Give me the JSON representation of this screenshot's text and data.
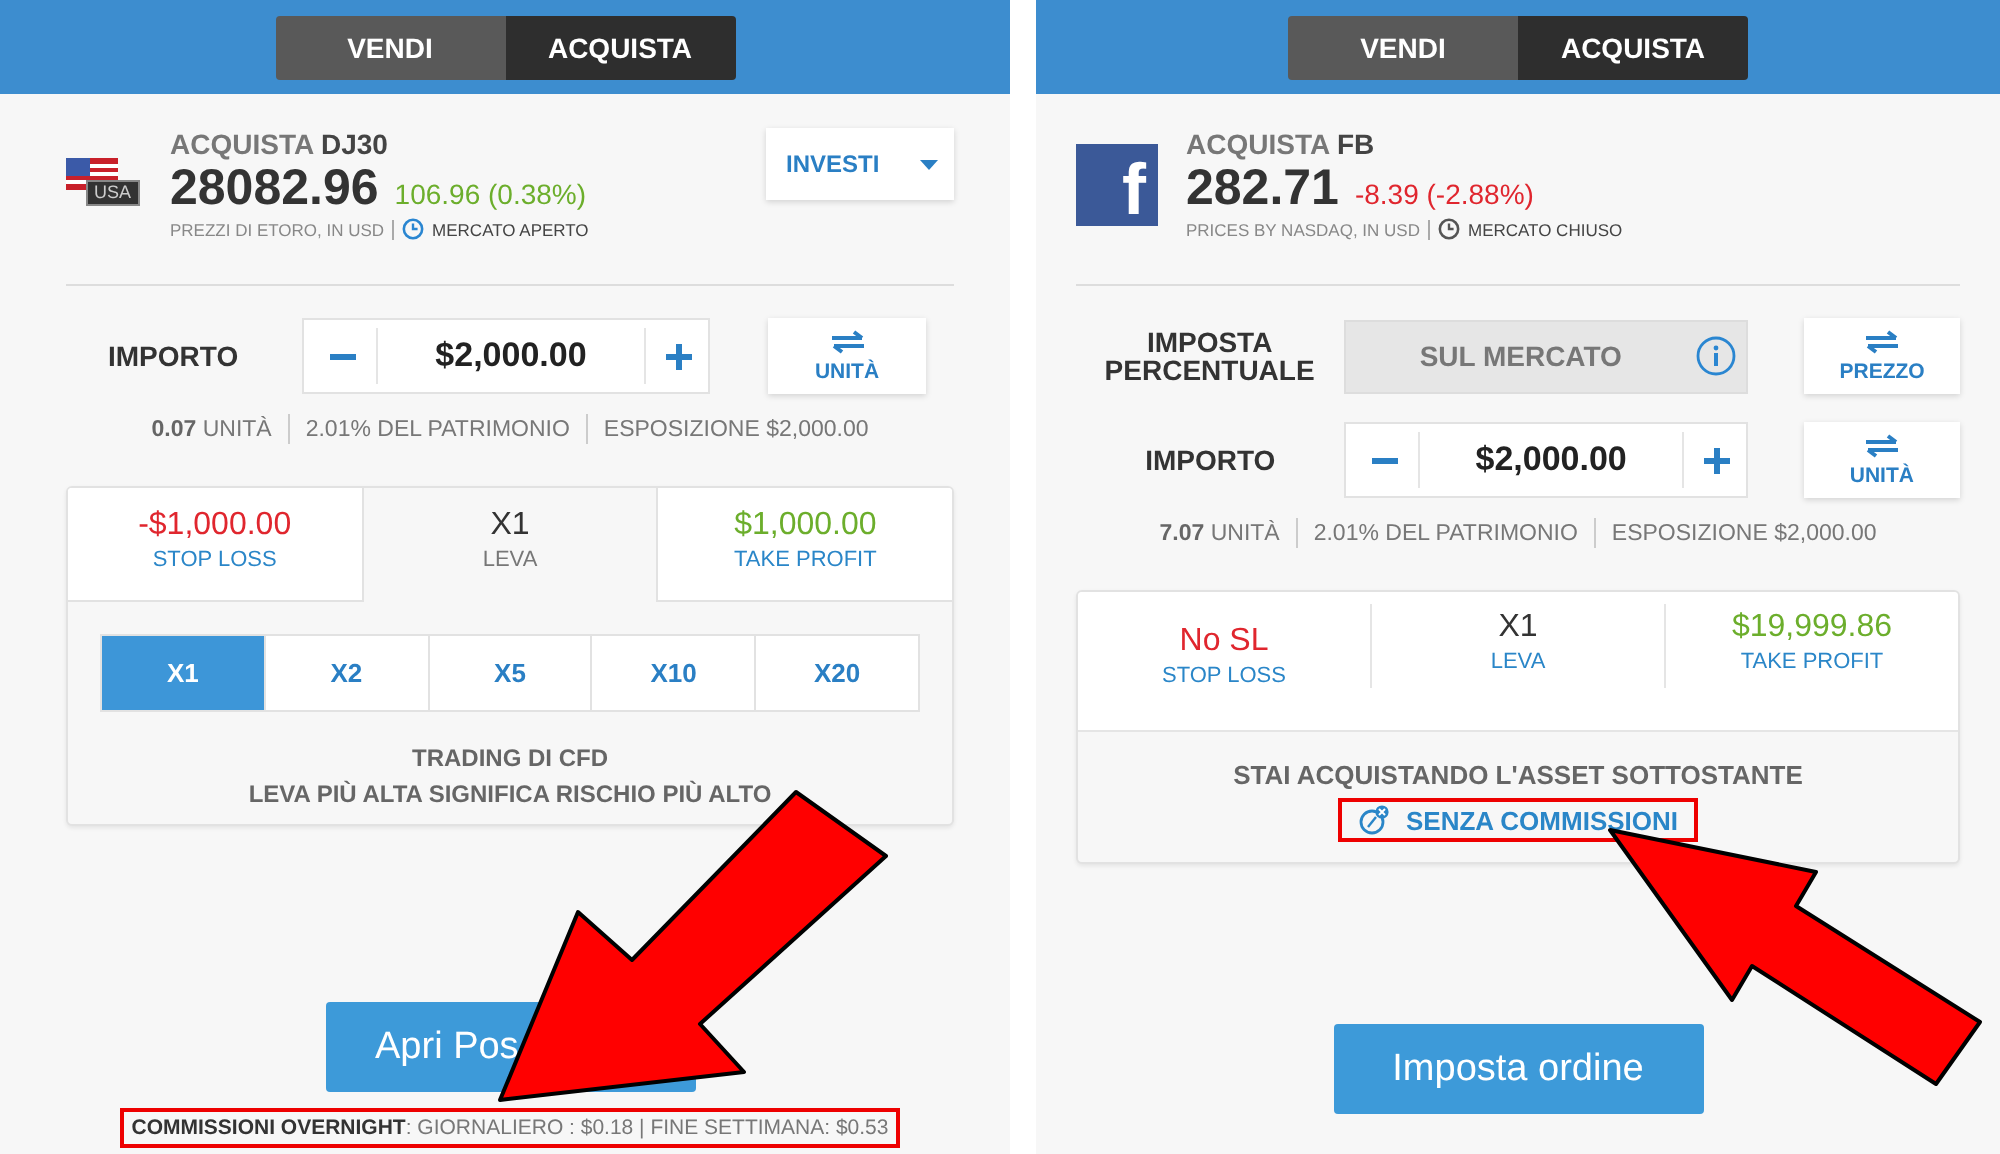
{
  "panels": [
    {
      "toggle": [
        {
          "label": "VENDI",
          "selected": false
        },
        {
          "label": "ACQUISTA",
          "selected": true
        }
      ],
      "instrument": {
        "logo": {
          "kind": "flag",
          "text": "USA"
        },
        "action": "ACQUISTA",
        "symbol": "DJ30",
        "price": "28082.96",
        "change": {
          "text": "106.96 (0.38%)",
          "color": "#6cae2c"
        },
        "source": "PREZZI DI ETORO, IN USD",
        "market": "MERCATO APERTO",
        "market_open": true
      },
      "menu_button": {
        "label": "INVESTI"
      },
      "fields": [
        {
          "kind": "amount",
          "label": "IMPORTO",
          "value": "$2,000.00",
          "switch": "UNITÀ"
        }
      ],
      "stats": [
        "**0.07** UNITÀ",
        "2.01% DEL PATRIMONIO",
        "ESPOSIZIONE $2,000.00"
      ],
      "risk": [
        {
          "value": "-$1,000.00",
          "label": "STOP LOSS",
          "color": "#e0262e",
          "selected": false
        },
        {
          "value": "X1",
          "label": "LEVA",
          "color": "#333333",
          "selected": true
        },
        {
          "value": "$1,000.00",
          "label": "TAKE PROFIT",
          "color": "#6cae2c",
          "selected": false
        }
      ],
      "leverage_options": [
        {
          "label": "X1",
          "selected": true
        },
        {
          "label": "X2",
          "selected": false
        },
        {
          "label": "X5",
          "selected": false
        },
        {
          "label": "X10",
          "selected": false
        },
        {
          "label": "X20",
          "selected": false
        }
      ],
      "notes": [
        "TRADING DI CFD",
        "LEVA PIÙ ALTA SIGNIFICA RISCHIO PIÙ ALTO"
      ],
      "action_button": {
        "label": "Apri Pos"
      },
      "fees_note": {
        "text": "**COMMISSIONI OVERNIGHT**: GIORNALIERO : $0.18 | FINE SETTIMANA: $0.53",
        "highlighted": true
      }
    },
    {
      "toggle": [
        {
          "label": "VENDI",
          "selected": false
        },
        {
          "label": "ACQUISTA",
          "selected": true
        }
      ],
      "instrument": {
        "logo": {
          "kind": "letter",
          "text": "f"
        },
        "action": "ACQUISTA",
        "symbol": "FB",
        "price": "282.71",
        "change": {
          "text": "-8.39 (-2.88%)",
          "color": "#e0262e"
        },
        "source": "PRICES BY NASDAQ, IN USD",
        "market": "MERCATO CHIUSO",
        "market_open": false
      },
      "fields": [
        {
          "kind": "rate",
          "label": "IMPOSTA PERCENTUALE",
          "value": "SUL MERCATO",
          "disabled": true,
          "switch": "PREZZO"
        },
        {
          "kind": "amount",
          "label": "IMPORTO",
          "value": "$2,000.00",
          "switch": "UNITÀ"
        }
      ],
      "stats": [
        "**7.07** UNITÀ",
        "2.01% DEL PATRIMONIO",
        "ESPOSIZIONE $2,000.00"
      ],
      "risk": [
        {
          "value": "No SL",
          "label": "STOP LOSS",
          "color": "#e0262e",
          "selected": false
        },
        {
          "value": "X1",
          "label": "LEVA",
          "color": "#333333",
          "selected": false
        },
        {
          "value": "$19,999.86",
          "label": "TAKE PROFIT",
          "color": "#6cae2c",
          "selected": false
        }
      ],
      "notes": [
        "STAI ACQUISTANDO L'ASSET SOTTOSTANTE"
      ],
      "link": {
        "label": "SENZA COMMISSIONI",
        "highlighted": true
      },
      "action_button": {
        "label": "Imposta ordine"
      }
    }
  ]
}
